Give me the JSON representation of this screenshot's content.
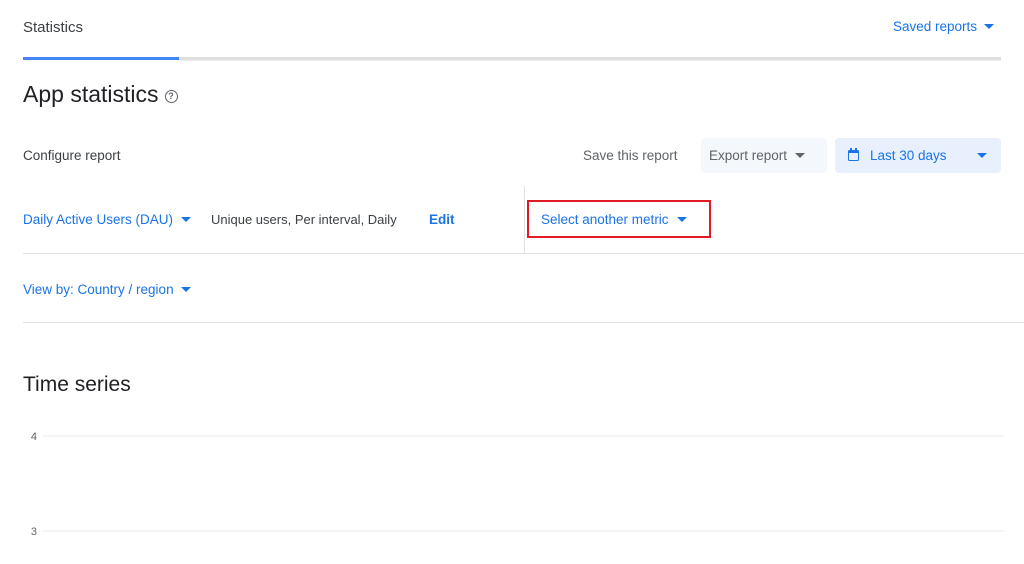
{
  "header": {
    "tab_title": "Statistics",
    "saved_reports_label": "Saved reports"
  },
  "page": {
    "title": "App statistics",
    "help_icon": "help-circle-icon"
  },
  "toolbar": {
    "configure_label": "Configure report",
    "save_label": "Save this report",
    "export_label": "Export report",
    "date_range_label": "Last 30 days",
    "date_icon": "calendar-icon"
  },
  "metric": {
    "name": "Daily Active Users (DAU)",
    "description": "Unique users, Per interval, Daily",
    "edit_label": "Edit",
    "select_another_label": "Select another metric"
  },
  "view_by": {
    "label": "View by: Country / region"
  },
  "time_series": {
    "title": "Time series"
  },
  "colors": {
    "accent": "#1a73e8",
    "highlight_box": "#e01b24",
    "tab_indicator": "#4285f4"
  },
  "chart_data": {
    "type": "line",
    "title": "Time series",
    "xlabel": "",
    "ylabel": "",
    "y_ticks": [
      4,
      3
    ],
    "ylim": [
      3,
      4
    ],
    "grid": true,
    "series": []
  }
}
